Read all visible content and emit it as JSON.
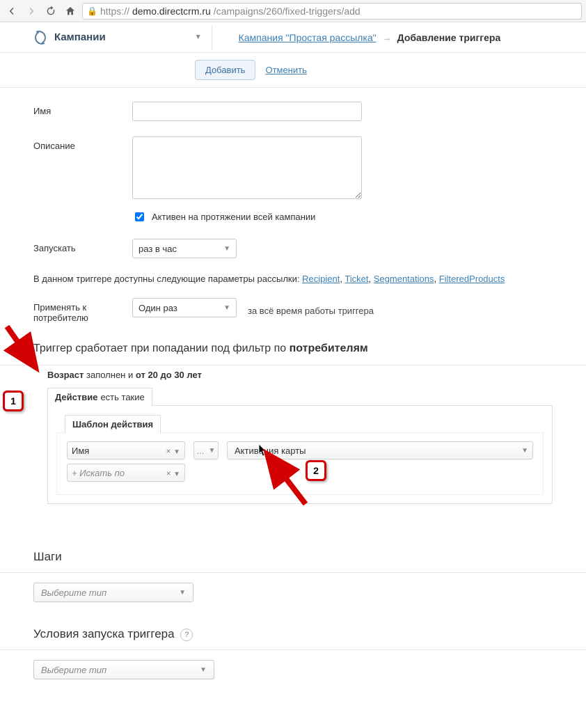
{
  "chrome": {
    "url_scheme": "https://",
    "url_host": "demo.directcrm.ru",
    "url_path": "/campaigns/260/fixed-triggers/add"
  },
  "header": {
    "campaigns_label": "Кампании",
    "breadcrumb_link": "Кампания \"Простая рассылка\"",
    "breadcrumb_arrow": "→",
    "breadcrumb_current": "Добавление триггера"
  },
  "actions": {
    "add": "Добавить",
    "cancel": "Отменить"
  },
  "form": {
    "name_label": "Имя",
    "name_value": "",
    "desc_label": "Описание",
    "desc_value": "",
    "active_label": "Активен на протяжении всей кампании",
    "active_checked": true,
    "run_label": "Запускать",
    "run_value": "раз в час",
    "params_prefix": "В данном триггере доступны следующие параметры рассылки: ",
    "params_links": [
      "Recipient",
      "Ticket",
      "Segmentations",
      "FilteredProducts"
    ],
    "apply_label_l1": "Применять к",
    "apply_label_l2": "потребителю",
    "apply_value": "Один раз",
    "apply_after": "за всё время работы триггера"
  },
  "filter": {
    "title_prefix": "Триггер сработает при попадании под фильтр по ",
    "title_bold": "потребителям",
    "age_b1": "Возраст",
    "age_mid": " заполнен и ",
    "age_b2": "от 20 до 30 лет",
    "action_b": "Действие",
    "action_tail": " есть такие",
    "template_title": "Шаблон действия",
    "chip_name": "Имя",
    "chip_search_placeholder": "+ Искать по",
    "chip_dots": "...",
    "chip_activation": "Активация карты"
  },
  "steps": {
    "title": "Шаги",
    "placeholder": "Выберите тип"
  },
  "conditions": {
    "title": "Условия запуска триггера",
    "placeholder": "Выберите тип"
  },
  "annotations": {
    "n1": "1",
    "n2": "2"
  }
}
